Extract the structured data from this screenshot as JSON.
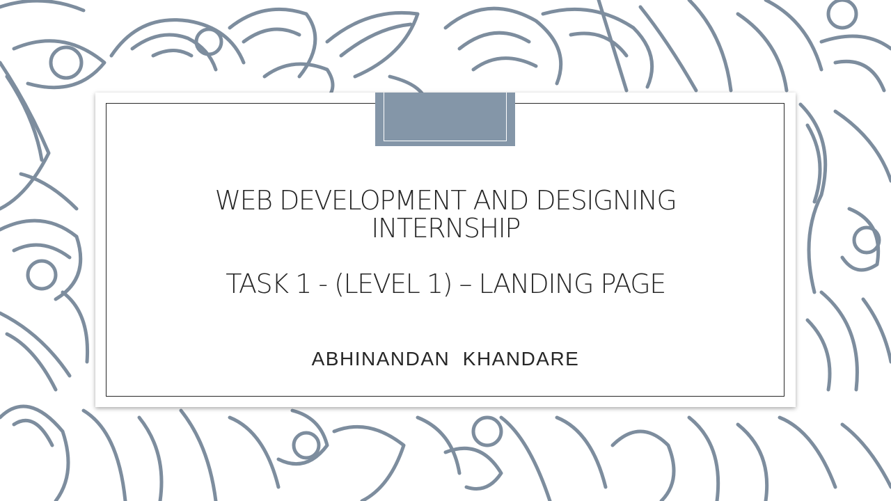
{
  "slide": {
    "title_line1": "WEB DEVELOPMENT AND DESIGNING",
    "title_line2": "INTERNSHIP",
    "title_line3": "TASK 1 - (LEVEL 1) – LANDING PAGE",
    "subtitle": "ABHINANDAN  KHANDARE"
  },
  "colors": {
    "pattern": "#7d8d9e",
    "accent_tab": "#8496a8",
    "text": "#262626",
    "background": "#ffffff"
  }
}
